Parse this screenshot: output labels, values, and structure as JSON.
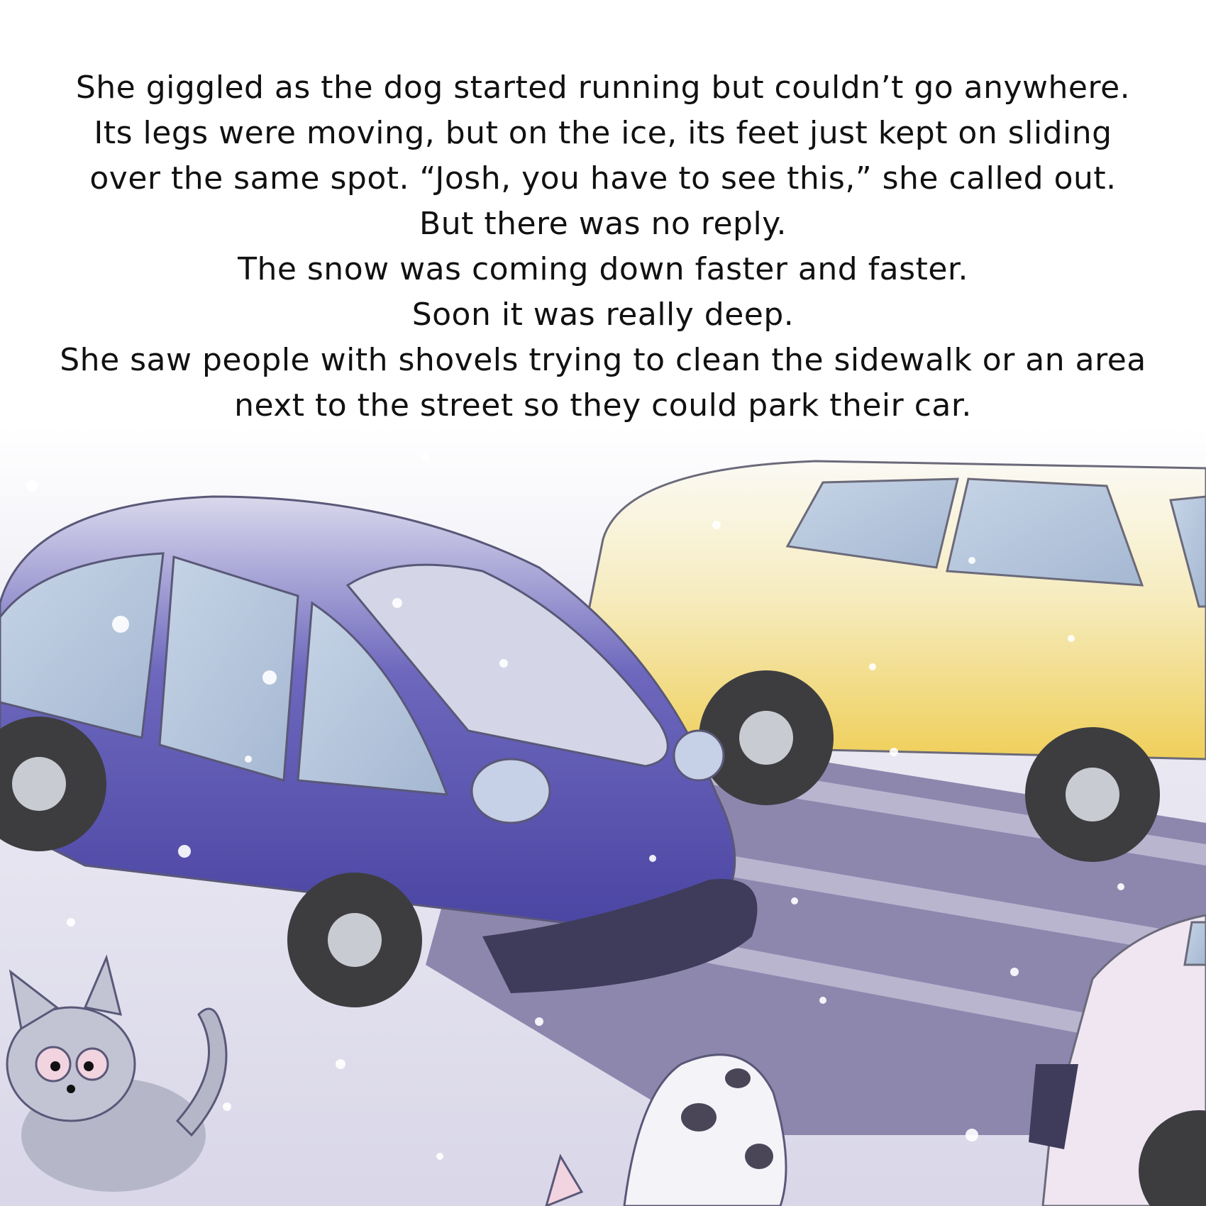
{
  "story": {
    "paragraph_1": "She giggled as the dog started running but couldn’t go anywhere. Its legs were moving, but on the ice, its feet just kept on sliding over the same spot. “Josh, you have to see this,” she called out.",
    "line_2": "But there was no reply.",
    "line_3": "The snow was coming down faster and faster.",
    "line_4": "Soon it was really deep.",
    "paragraph_5": "She saw people with shovels trying to clean the sidewalk or an area next to the street so they could park their car."
  },
  "colors": {
    "text": "#111111",
    "snow": "#ecebf4",
    "road": "#8c85ad",
    "blue_car": "#4d48a6",
    "yellow_car": "#f2d76a",
    "tire": "#3d3d40"
  },
  "illustration": {
    "icons": [
      "blue-car",
      "yellow-car",
      "pink-car",
      "gray-cat",
      "spotted-dog",
      "snowflakes"
    ]
  }
}
